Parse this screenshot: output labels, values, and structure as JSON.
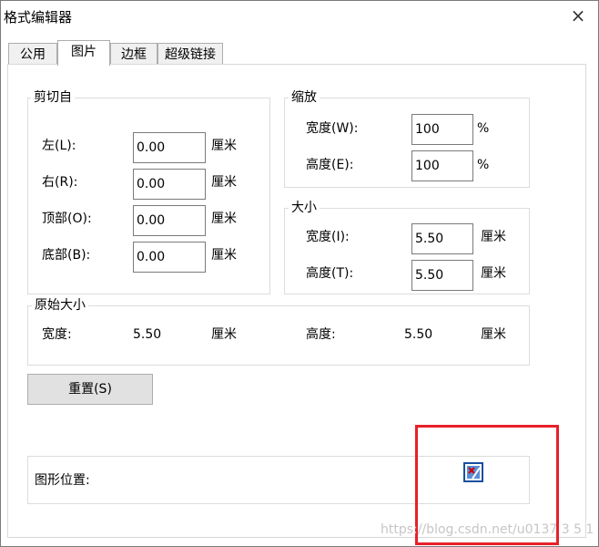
{
  "window": {
    "title": "格式编辑器",
    "close_symbol": "×"
  },
  "tabs": [
    {
      "label": "公用",
      "active": false
    },
    {
      "label": "图片",
      "active": true
    },
    {
      "label": "边框",
      "active": false
    },
    {
      "label": "超级链接",
      "active": false
    }
  ],
  "crop": {
    "title": "剪切自",
    "left_label": "左(L):",
    "left_value": "0.00",
    "right_label": "右(R):",
    "right_value": "0.00",
    "top_label": "顶部(O):",
    "top_value": "0.00",
    "bottom_label": "底部(B):",
    "bottom_value": "0.00",
    "unit": "厘米"
  },
  "scale": {
    "title": "缩放",
    "width_label": "宽度(W):",
    "width_value": "100",
    "height_label": "高度(E):",
    "height_value": "100",
    "unit": "%"
  },
  "size": {
    "title": "大小",
    "width_label": "宽度(I):",
    "width_value": "5.50",
    "height_label": "高度(T):",
    "height_value": "5.50",
    "unit": "厘米"
  },
  "original_size": {
    "title": "原始大小",
    "width_label": "宽度:",
    "width_value": "5.50",
    "height_label": "高度:",
    "height_value": "5.50",
    "unit": "厘米"
  },
  "reset_button": "重置(S)",
  "graphic_position": {
    "label": "图形位置:"
  },
  "highlight_color": "#e8202a",
  "watermark": "https://blog.csdn.net/u0137 3 5 1 1"
}
